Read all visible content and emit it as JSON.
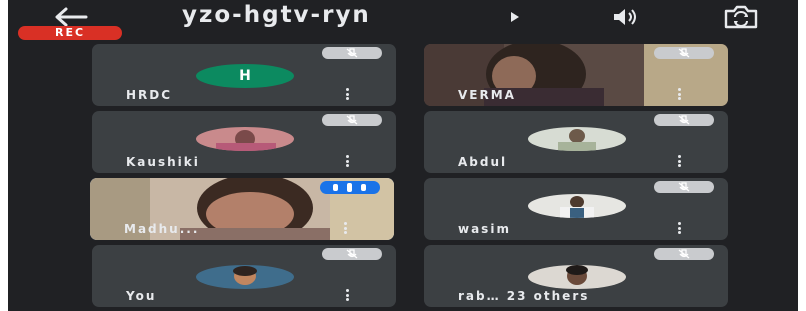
{
  "meeting": {
    "code": "yzo-hgtv-ryn",
    "recording_label": "REC"
  },
  "icons": {
    "back": "arrow-left-icon",
    "caret": "caret-right-icon",
    "audio": "speaker-icon",
    "switch_camera": "switch-camera-icon",
    "muted": "mic-off-icon",
    "speaking": "speaking-indicator-icon",
    "more": "more-vert-icon"
  },
  "colors": {
    "background": "#202124",
    "tile": "#3c4043",
    "recording": "#d93025",
    "active_speaker": "#1a73e8",
    "avatar_h": "#0c8a60"
  },
  "participants": [
    {
      "name": "HRDC",
      "avatar_letter": "H",
      "muted": true
    },
    {
      "name": "VERMA",
      "muted": true
    },
    {
      "name": "Kaushiki",
      "muted": true
    },
    {
      "name": "Abdul",
      "muted": true
    },
    {
      "name": "Madhu...",
      "muted": false,
      "speaking": true
    },
    {
      "name": "wasim",
      "muted": true
    },
    {
      "name": "You",
      "muted": true
    },
    {
      "name": "rab… 23 others",
      "muted": true
    }
  ]
}
